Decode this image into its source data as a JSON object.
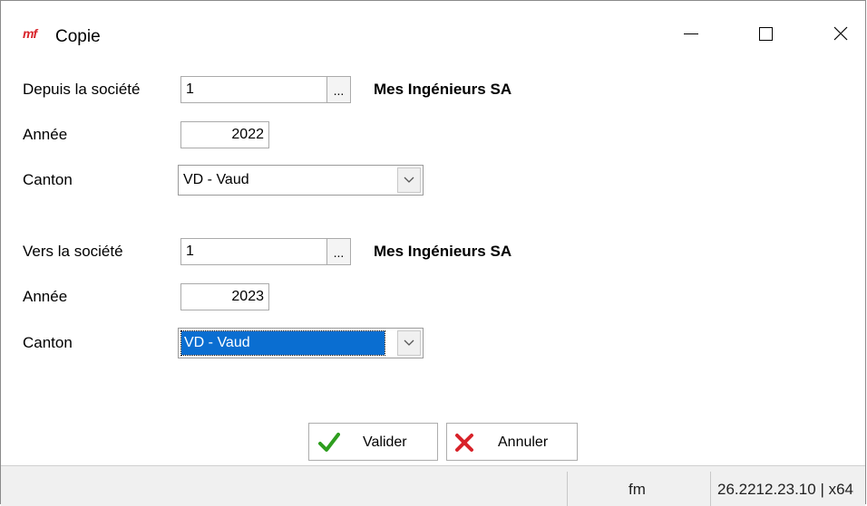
{
  "window": {
    "app_logo": "mf",
    "title": "Copie"
  },
  "source": {
    "company_label": "Depuis la société",
    "company_value": "1",
    "browse_label": "...",
    "company_name": "Mes Ingénieurs SA",
    "year_label": "Année",
    "year_value": "2022",
    "canton_label": "Canton",
    "canton_value": "VD - Vaud"
  },
  "target": {
    "company_label": "Vers la société",
    "company_value": "1",
    "browse_label": "...",
    "company_name": "Mes Ingénieurs SA",
    "year_label": "Année",
    "year_value": "2023",
    "canton_label": "Canton",
    "canton_value": "VD - Vaud"
  },
  "buttons": {
    "ok_label": "Valider",
    "cancel_label": "Annuler"
  },
  "status": {
    "user": "fm",
    "version": "26.2212.23.10 | x64"
  },
  "icons": {
    "ok": "checkmark-icon",
    "cancel": "cross-icon",
    "dropdown": "chevron-down-icon"
  },
  "colors": {
    "logo": "#d8232a",
    "selection": "#0a6ed1",
    "ok_icon": "#2e9e1f",
    "cancel_icon": "#d8232a"
  }
}
